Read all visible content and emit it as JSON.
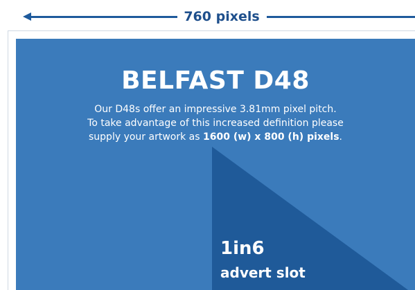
{
  "dimension": {
    "label": "760 pixels"
  },
  "screen": {
    "title": "BELFAST D48",
    "line1": "Our D48s offer an impressive 3.81mm pixel pitch.",
    "line2": "To take advantage of this increased definition please",
    "line3_prefix": "supply your artwork as ",
    "line3_strong": "1600 (w) x 800 (h) pixels",
    "line3_suffix": "."
  },
  "slot": {
    "number": "1in6",
    "label": "advert slot"
  },
  "colors": {
    "screen_background": "#3b7bbb",
    "slot_triangle": "#1f5a99",
    "dimension_line": "#1e5a9c",
    "text": "#ffffff"
  }
}
